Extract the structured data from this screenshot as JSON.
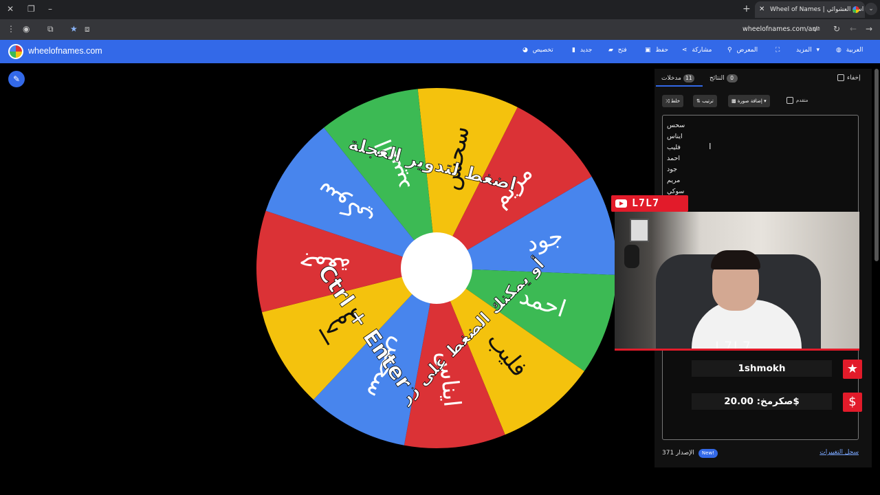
{
  "browser": {
    "tab_title": "Wheel of Names | اسم العشوائي",
    "url": "wheelofnames.com/ar/"
  },
  "site": {
    "name": "wheelofnames.com",
    "nav": {
      "customize": "تخصيص",
      "new": "جديد",
      "open": "فتح",
      "save": "حفظ",
      "share": "مشاركة",
      "gallery": "المعرض",
      "more": "المزيد",
      "language": "العربية"
    }
  },
  "wheel": {
    "segments": [
      {
        "label": "سحس",
        "color": "#f4c20d"
      },
      {
        "label": "مريم",
        "color": "#db3236"
      },
      {
        "label": "جود",
        "color": "#4885ed"
      },
      {
        "label": "احمد",
        "color": "#3cba54"
      },
      {
        "label": "فليب",
        "color": "#f4c20d"
      },
      {
        "label": "ايناس",
        "color": "#db3236"
      },
      {
        "label": "سحس",
        "color": "#4885ed"
      },
      {
        "label": "احمد",
        "color": "#f4c20d"
      },
      {
        "label": "جمعة",
        "color": "#db3236"
      },
      {
        "label": "سوكي",
        "color": "#4885ed"
      },
      {
        "label": "السيد",
        "color": "#3cba54"
      }
    ],
    "hint_top": "اضغط لتدوير العجلة",
    "hint_mid": "أو يمكنك الضغط على زر",
    "hint_keys": "Ctrl + Enter"
  },
  "panel": {
    "hide_label": "إخفاء",
    "results_label": "النتائج",
    "results_count": "0",
    "entries_label": "مدخلات",
    "entries_count": "11",
    "shuffle": "خلط",
    "sort": "ترتيب",
    "add_image": "إضافة صورة",
    "advanced": "متقدم",
    "entries": [
      "سحس",
      "ايناس",
      "فليب",
      "احمد",
      "جود",
      "مريم",
      "سوكي"
    ],
    "version_label": "الإصدار",
    "version_number": "371",
    "new_badge": "New!",
    "changelog": "سجل التغييرات"
  },
  "stream": {
    "channel": "L7L7",
    "watermark": "L7L7",
    "donor": "1shmokh",
    "donation": "صكرمخ: 20.00$"
  }
}
